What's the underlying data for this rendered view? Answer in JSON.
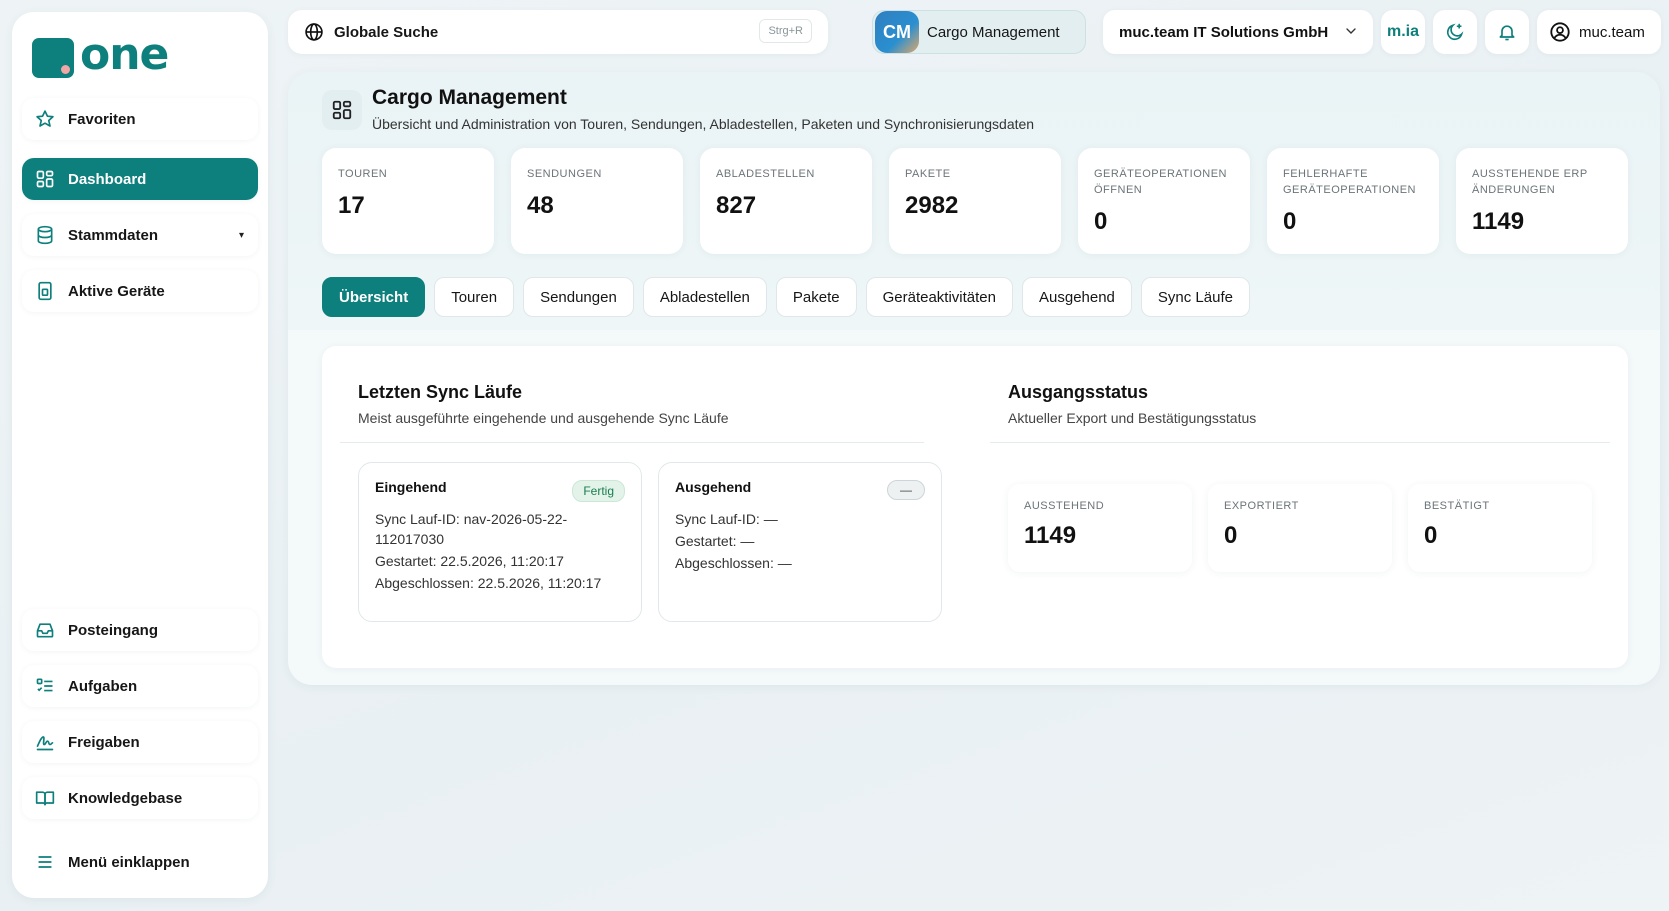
{
  "brand": {
    "name": "one",
    "accent": "#0d7f7c"
  },
  "topbar": {
    "search_label": "Globale Suche",
    "search_shortcut": "Strg+R",
    "app_badge": "CM",
    "app_name": "Cargo Management",
    "company": "muc.team IT Solutions GmbH",
    "assistant": "m.ia",
    "user": "muc.team"
  },
  "sidebar": {
    "items": [
      {
        "label": "Favoriten",
        "icon": "star-icon"
      },
      {
        "label": "Dashboard",
        "icon": "dashboard-icon",
        "active": true
      },
      {
        "label": "Stammdaten",
        "icon": "database-icon",
        "caret": "▾"
      },
      {
        "label": "Aktive Geräte",
        "icon": "device-icon"
      },
      {
        "label": "Posteingang",
        "icon": "inbox-icon"
      },
      {
        "label": "Aufgaben",
        "icon": "tasks-icon"
      },
      {
        "label": "Freigaben",
        "icon": "signature-icon"
      },
      {
        "label": "Knowledgebase",
        "icon": "book-icon"
      },
      {
        "label": "Menü einklappen",
        "icon": "menu-icon"
      }
    ]
  },
  "header": {
    "title": "Cargo Management",
    "subtitle": "Übersicht und Administration von Touren, Sendungen, Abladestellen, Paketen und Synchronisierungsdaten"
  },
  "stats": [
    {
      "label": "Touren",
      "value": "17"
    },
    {
      "label": "Sendungen",
      "value": "48"
    },
    {
      "label": "Abladestellen",
      "value": "827"
    },
    {
      "label": "Pakete",
      "value": "2982"
    },
    {
      "label": "Geräteoperationen öffnen",
      "value": "0"
    },
    {
      "label": "Fehlerhafte Geräteoperationen",
      "value": "0"
    },
    {
      "label": "Ausstehende ERP Änderungen",
      "value": "1149"
    }
  ],
  "tabs": [
    "Übersicht",
    "Touren",
    "Sendungen",
    "Abladestellen",
    "Pakete",
    "Geräteaktivitäten",
    "Ausgehend",
    "Sync Läufe"
  ],
  "sync_panel": {
    "title": "Letzten Sync Läufe",
    "subtitle": "Meist ausgeführte eingehende und ausgehende Sync Läufe",
    "incoming": {
      "title": "Eingehend",
      "badge": "Fertig",
      "id": "Sync Lauf-ID: nav-2026-05-22-112017030",
      "started": "Gestartet: 22.5.2026, 11:20:17",
      "finished": "Abgeschlossen: 22.5.2026, 11:20:17"
    },
    "outgoing": {
      "title": "Ausgehend",
      "badge": "—",
      "id": "Sync Lauf-ID: —",
      "started": "Gestartet: —",
      "finished": "Abgeschlossen: —"
    }
  },
  "output_panel": {
    "title": "Ausgangsstatus",
    "subtitle": "Aktueller Export und Bestätigungsstatus",
    "cards": [
      {
        "label": "Ausstehend",
        "value": "1149"
      },
      {
        "label": "Exportiert",
        "value": "0"
      },
      {
        "label": "Bestätigt",
        "value": "0"
      }
    ]
  }
}
